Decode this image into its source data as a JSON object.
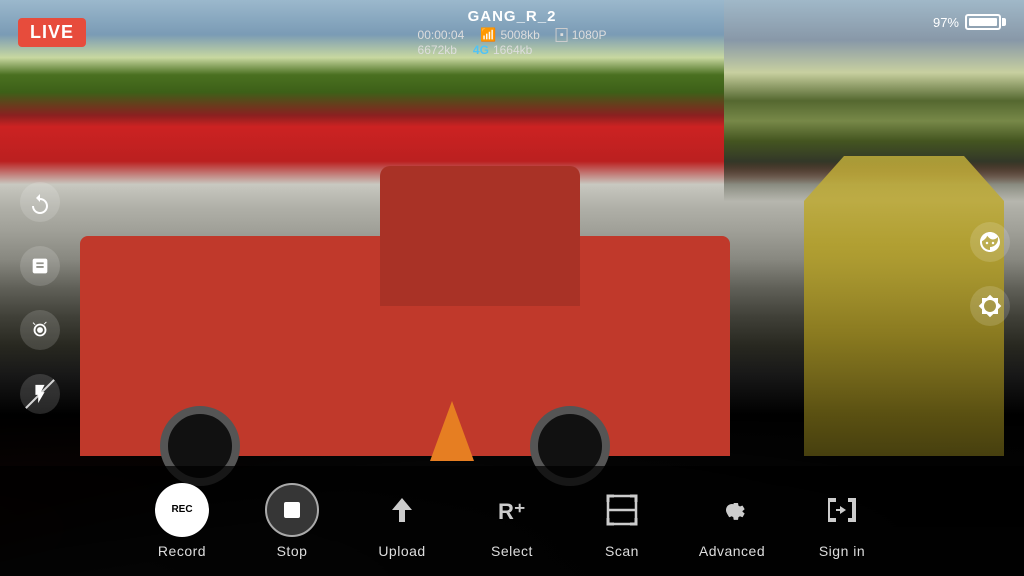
{
  "hud": {
    "live_label": "LIVE",
    "gang_name": "GANG_R_2",
    "timer": "00:00:04",
    "wifi_speed": "5008kb",
    "resolution": "1080P",
    "data_used": "6672kb",
    "lte_label": "4G",
    "lte_speed": "1664kb",
    "battery_pct": "97%"
  },
  "toolbar": {
    "buttons": [
      {
        "id": "record",
        "icon": "REC",
        "label": "Record"
      },
      {
        "id": "stop",
        "icon": "⏹",
        "label": "Stop"
      },
      {
        "id": "upload",
        "icon": "↑",
        "label": "Upload"
      },
      {
        "id": "select",
        "icon": "R⁺",
        "label": "Select"
      },
      {
        "id": "scan",
        "icon": "⛶",
        "label": "Scan"
      },
      {
        "id": "advanced",
        "icon": "⚙",
        "label": "Advanced"
      },
      {
        "id": "signin",
        "icon": "⇥",
        "label": "Sign in"
      }
    ]
  },
  "left_icons": [
    {
      "id": "rotate-camera",
      "symbol": "⟳"
    },
    {
      "id": "film-icon",
      "symbol": "🎞"
    },
    {
      "id": "photo-icon",
      "symbol": "📷"
    },
    {
      "id": "flash-off-icon",
      "symbol": "⚡"
    }
  ],
  "right_icons": [
    {
      "id": "face-icon",
      "symbol": "😷"
    },
    {
      "id": "brightness-icon",
      "symbol": "☀"
    }
  ]
}
